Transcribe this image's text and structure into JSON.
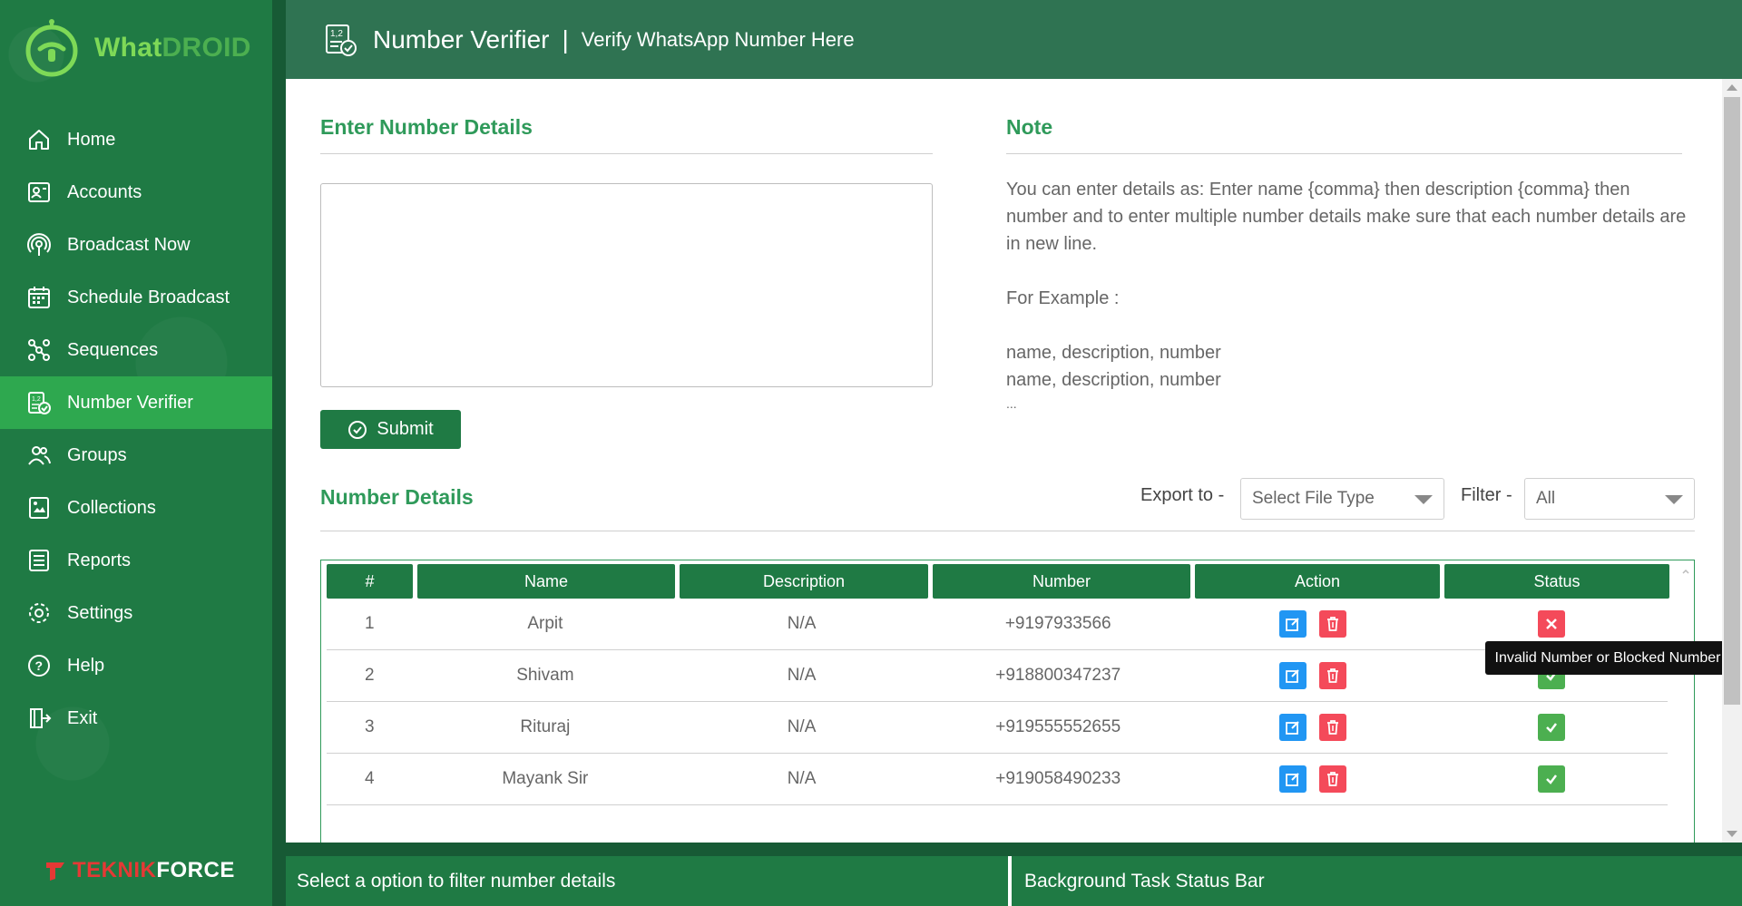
{
  "app": {
    "logo_what": "What",
    "logo_droid": "DROID",
    "brand_part1": "TEKNIK",
    "brand_part2": "FORCE"
  },
  "header": {
    "title": "Number Verifier",
    "separator": "|",
    "subtitle": "Verify WhatsApp Number Here"
  },
  "sidebar": {
    "items": [
      {
        "label": "Home",
        "icon": "home-icon"
      },
      {
        "label": "Accounts",
        "icon": "accounts-icon"
      },
      {
        "label": "Broadcast Now",
        "icon": "broadcast-icon"
      },
      {
        "label": "Schedule Broadcast",
        "icon": "calendar-icon"
      },
      {
        "label": "Sequences",
        "icon": "sequences-icon"
      },
      {
        "label": "Number Verifier",
        "icon": "number-verifier-icon",
        "active": true
      },
      {
        "label": "Groups",
        "icon": "groups-icon"
      },
      {
        "label": "Collections",
        "icon": "collections-icon"
      },
      {
        "label": "Reports",
        "icon": "reports-icon"
      },
      {
        "label": "Settings",
        "icon": "gear-icon"
      },
      {
        "label": "Help",
        "icon": "help-icon"
      },
      {
        "label": "Exit",
        "icon": "exit-icon"
      }
    ]
  },
  "form": {
    "title": "Enter Number Details",
    "textarea_value": "",
    "submit_label": "Submit"
  },
  "note": {
    "title": "Note",
    "body": "You can enter details as: Enter name {comma} then description {comma} then number and to enter multiple number details make sure that each number details are in new line.",
    "example_label": "For Example :",
    "example_lines": [
      "name, description, number",
      "name, description, number",
      "..."
    ]
  },
  "details": {
    "title": "Number Details",
    "export_label": "Export to -",
    "export_placeholder": "Select File Type",
    "filter_label": "Filter -",
    "filter_value": "All",
    "columns": [
      "#",
      "Name",
      "Description",
      "Number",
      "Action",
      "Status"
    ],
    "rows": [
      {
        "idx": "1",
        "name": "Arpit",
        "description": "N/A",
        "number": "+9197933566",
        "status": "invalid"
      },
      {
        "idx": "2",
        "name": "Shivam",
        "description": "N/A",
        "number": "+918800347237",
        "status": "valid"
      },
      {
        "idx": "3",
        "name": "Rituraj",
        "description": "N/A",
        "number": "+919555552655",
        "status": "valid"
      },
      {
        "idx": "4",
        "name": "Mayank Sir",
        "description": "N/A",
        "number": "+919058490233",
        "status": "valid"
      }
    ],
    "tooltip": "Invalid Number or Blocked Number"
  },
  "statusbar": {
    "left": "Select a option to filter number details",
    "right": "Background Task Status Bar"
  },
  "colors": {
    "sidebar": "#1f7a44",
    "active": "#2ea84f",
    "header": "#2f7352",
    "accent_text": "#2f9a5a",
    "edit": "#2196f3",
    "delete": "#f44a5a",
    "valid": "#4caf50"
  }
}
